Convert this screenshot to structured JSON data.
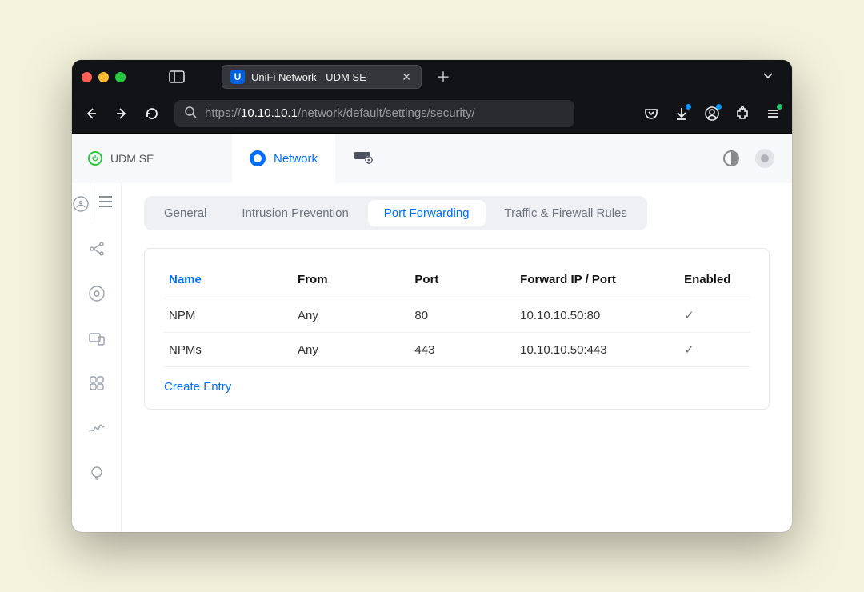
{
  "browser": {
    "tab_title": "UniFi Network - UDM SE",
    "tab_badge_letter": "U",
    "url_scheme": "https://",
    "url_host": "10.10.10.1",
    "url_path": "/network/default/settings/security/"
  },
  "header": {
    "site_name": "UDM SE",
    "tabs": [
      {
        "label": "Network",
        "active": true
      }
    ]
  },
  "subtabs": {
    "items": [
      {
        "label": "General",
        "active": false
      },
      {
        "label": "Intrusion Prevention",
        "active": false
      },
      {
        "label": "Port Forwarding",
        "active": true
      },
      {
        "label": "Traffic & Firewall Rules",
        "active": false
      }
    ]
  },
  "table": {
    "columns": {
      "name": "Name",
      "from": "From",
      "port": "Port",
      "forward": "Forward IP / Port",
      "enabled": "Enabled"
    },
    "rows": [
      {
        "name": "NPM",
        "from": "Any",
        "port": "80",
        "forward": "10.10.10.50:80",
        "enabled": true
      },
      {
        "name": "NPMs",
        "from": "Any",
        "port": "443",
        "forward": "10.10.10.50:443",
        "enabled": true
      }
    ],
    "create_label": "Create Entry"
  }
}
